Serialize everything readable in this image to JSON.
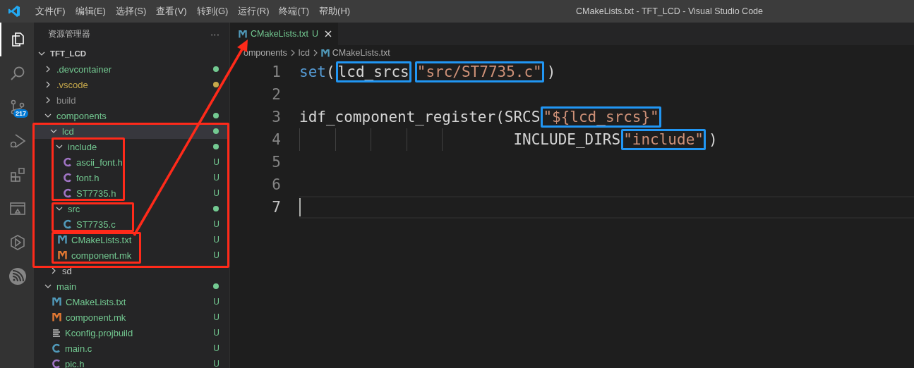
{
  "title_bar": {
    "menus": [
      "文件(F)",
      "编辑(E)",
      "选择(S)",
      "查看(V)",
      "转到(G)",
      "运行(R)",
      "终端(T)",
      "帮助(H)"
    ],
    "title": "CMakeLists.txt - TFT_LCD - Visual Studio Code"
  },
  "activity_bar": {
    "items": [
      {
        "kind": "explorer",
        "selected": true
      },
      {
        "kind": "search",
        "selected": false
      },
      {
        "kind": "source-control",
        "selected": false,
        "badge": "217"
      },
      {
        "kind": "run-debug",
        "selected": false
      },
      {
        "kind": "extensions",
        "selected": false
      },
      {
        "kind": "remote",
        "selected": false
      },
      {
        "kind": "hexagon",
        "selected": false
      },
      {
        "kind": "espressif",
        "selected": false
      }
    ]
  },
  "sidebar": {
    "title": "资源管理器",
    "more": "···",
    "tree": {
      "name": "TFT_LCD",
      "expanded": true,
      "children": [
        {
          "name": ".devcontainer",
          "kind": "folder",
          "expanded": false,
          "selected": false,
          "color": "#73c991",
          "dot": true
        },
        {
          "name": ".vscode",
          "kind": "folder",
          "expanded": false,
          "selected": false,
          "color": "#c7a94b",
          "dot": true
        },
        {
          "name": "build",
          "kind": "folder",
          "expanded": false,
          "selected": false,
          "color": "#8c8c8c",
          "dot": false
        },
        {
          "name": "components",
          "kind": "folder",
          "expanded": true,
          "selected": false,
          "color": "#73c991",
          "dot": true,
          "children": [
            {
              "name": "lcd",
              "kind": "folder",
              "expanded": true,
              "selected": true,
              "color": "#73c991",
              "dot": true,
              "children": [
                {
                  "name": "include",
                  "kind": "folder",
                  "expanded": true,
                  "selected": false,
                  "color": "#73c991",
                  "dot": true,
                  "children": [
                    {
                      "name": "ascii_font.h",
                      "kind": "h",
                      "selected": false,
                      "color": "#73c991",
                      "badge": "U"
                    },
                    {
                      "name": "font.h",
                      "kind": "h",
                      "selected": false,
                      "color": "#73c991",
                      "badge": "U"
                    },
                    {
                      "name": "ST7735.h",
                      "kind": "h",
                      "selected": false,
                      "color": "#73c991",
                      "badge": "U"
                    }
                  ]
                },
                {
                  "name": "src",
                  "kind": "folder",
                  "expanded": true,
                  "selected": false,
                  "color": "#73c991",
                  "dot": true,
                  "children": [
                    {
                      "name": "ST7735.c",
                      "kind": "c",
                      "selected": false,
                      "color": "#73c991",
                      "badge": "U"
                    }
                  ]
                },
                {
                  "name": "CMakeLists.txt",
                  "kind": "cmake",
                  "selected": false,
                  "color": "#73c991",
                  "badge": "U"
                },
                {
                  "name": "component.mk",
                  "kind": "make",
                  "selected": false,
                  "color": "#73c991",
                  "badge": "U"
                }
              ]
            },
            {
              "name": "sd",
              "kind": "folder",
              "expanded": false,
              "selected": false,
              "color": "#cccccc",
              "dot": false
            }
          ]
        },
        {
          "name": "main",
          "kind": "folder",
          "expanded": true,
          "selected": false,
          "color": "#73c991",
          "dot": true,
          "children": [
            {
              "name": "CMakeLists.txt",
              "kind": "cmake",
              "selected": false,
              "color": "#73c991",
              "badge": "U"
            },
            {
              "name": "component.mk",
              "kind": "make",
              "selected": false,
              "color": "#73c991",
              "badge": "U"
            },
            {
              "name": "Kconfig.projbuild",
              "kind": "kconfig",
              "selected": false,
              "color": "#73c991",
              "badge": "U"
            },
            {
              "name": "main.c",
              "kind": "c",
              "selected": false,
              "color": "#73c991",
              "badge": "U"
            },
            {
              "name": "pic.h",
              "kind": "h",
              "selected": false,
              "color": "#73c991",
              "badge": "U"
            }
          ]
        }
      ]
    }
  },
  "editor": {
    "tabs": [
      {
        "label": "CMakeLists.txt",
        "kind": "cmake",
        "badge": "U",
        "selected": true
      }
    ],
    "breadcrumb": [
      {
        "label": "omponents",
        "kind": "folder"
      },
      {
        "label": "lcd",
        "kind": "folder"
      },
      {
        "label": "CMakeLists.txt",
        "kind": "cmake"
      }
    ],
    "lines": [
      {
        "number": "1",
        "current": false,
        "tokens": [
          {
            "text": "set",
            "kind": "keyword",
            "boxed": false
          },
          {
            "text": "(",
            "kind": "plain",
            "boxed": false
          },
          {
            "text": "lcd_srcs",
            "kind": "plain",
            "boxed": true
          },
          {
            "text": "\"src/ST7735.c\"",
            "kind": "string",
            "boxed": true
          },
          {
            "text": ")",
            "kind": "plain",
            "boxed": false
          }
        ]
      },
      {
        "number": "2",
        "current": false
      },
      {
        "number": "3",
        "current": false,
        "tokens": [
          {
            "text": "idf_component_register(SRCS",
            "kind": "plain",
            "boxed": false
          },
          {
            "text": "\"${lcd_srcs}\"",
            "kind": "string",
            "boxed": true
          }
        ]
      },
      {
        "number": "4",
        "current": false,
        "tokens": [
          {
            "text": "                        INCLUDE_DIRS",
            "kind": "plain",
            "boxed": false
          },
          {
            "text": "\"include\"",
            "kind": "string",
            "boxed": true
          },
          {
            "text": ")",
            "kind": "plain",
            "boxed": false
          }
        ]
      },
      {
        "number": "5",
        "current": false
      },
      {
        "number": "6",
        "current": false
      },
      {
        "number": "7",
        "current": true
      }
    ]
  }
}
